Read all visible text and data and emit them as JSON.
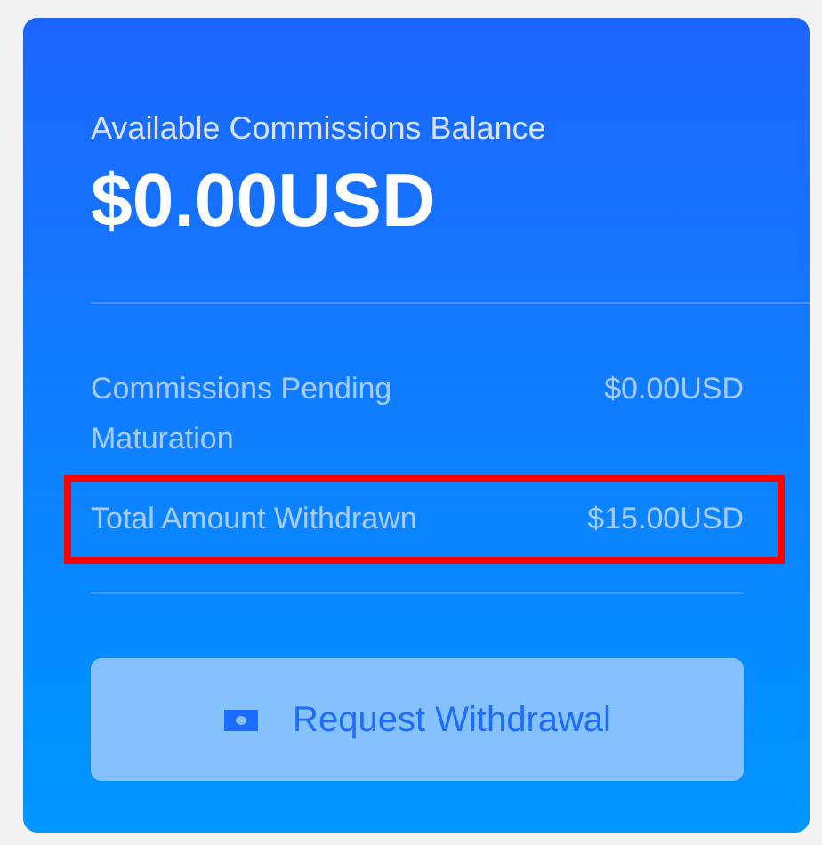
{
  "balance": {
    "label": "Available Commissions Balance",
    "amount": "$0.00USD"
  },
  "rows": [
    {
      "label": "Commissions Pending Maturation",
      "value": "$0.00USD",
      "highlighted": false
    },
    {
      "label": "Total Amount Withdrawn",
      "value": "$15.00USD",
      "highlighted": true
    }
  ],
  "button": {
    "label": "Request Withdrawal",
    "disabled": true
  }
}
